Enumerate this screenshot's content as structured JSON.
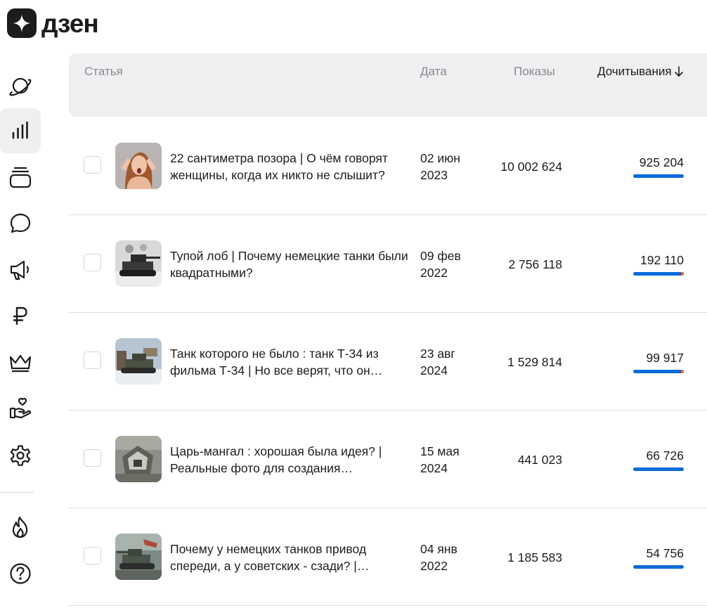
{
  "app": {
    "logo_text": "дзен"
  },
  "sidebar": {
    "items": [
      {
        "icon": "planet-icon"
      },
      {
        "icon": "stats-icon",
        "active": true
      },
      {
        "icon": "stack-icon"
      },
      {
        "icon": "chat-icon"
      },
      {
        "icon": "megaphone-icon"
      },
      {
        "icon": "ruble-icon"
      },
      {
        "icon": "crown-icon"
      },
      {
        "icon": "hand-heart-icon"
      },
      {
        "icon": "gear-icon"
      },
      {
        "icon": "flame-icon"
      },
      {
        "icon": "help-icon"
      }
    ]
  },
  "table": {
    "headers": {
      "article": "Статья",
      "date": "Дата",
      "views": "Показы",
      "reads": "Дочитывания"
    },
    "sort_icon": "arrow-down-icon",
    "rows": [
      {
        "title": "22 сантиметра позора | О чём говорят женщины, когда их никто не слышит?",
        "date_line1": "02 июн",
        "date_line2": "2023",
        "views": "10 002 624",
        "reads": "925 204",
        "bar_orange_fraction": 0
      },
      {
        "title": "Тупой лоб | Почему немецкие танки были квадратными?",
        "date_line1": "09 фев",
        "date_line2": "2022",
        "views": "2 756 118",
        "reads": "192 110",
        "bar_orange_fraction": 0.06
      },
      {
        "title": "Танк которого не было : танк Т-34 из фильма Т-34 | Но все верят, что он…",
        "date_line1": "23 авг",
        "date_line2": "2024",
        "views": "1 529 814",
        "reads": "99 917",
        "bar_orange_fraction": 0.05
      },
      {
        "title": "Царь-мангал : хорошая была идея? | Реальные фото для создания…",
        "date_line1": "15 мая",
        "date_line2": "2024",
        "views": "441 023",
        "reads": "66 726",
        "bar_orange_fraction": 0
      },
      {
        "title": "Почему у немецких танков привод спереди, а у советских - сзади? |…",
        "date_line1": "04 янв",
        "date_line2": "2022",
        "views": "1 185 583",
        "reads": "54 756",
        "bar_orange_fraction": 0
      }
    ]
  },
  "colors": {
    "accent_blue": "#0a6ad8",
    "accent_orange": "#f05a28",
    "header_bg": "#efeff1"
  }
}
